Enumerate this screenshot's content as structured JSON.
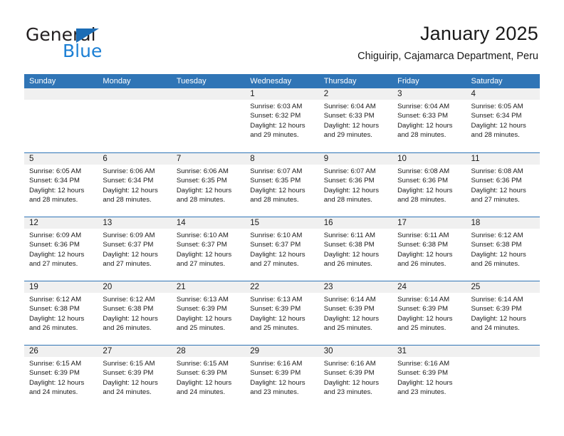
{
  "brand": {
    "name_part1": "General",
    "name_part2": "Blue",
    "triangle_color": "#1b6cb5",
    "blue_color": "#1b7fd4"
  },
  "header": {
    "title": "January 2025",
    "subtitle": "Chiguirip, Cajamarca Department, Peru"
  },
  "theme": {
    "header_blue": "#3075b6",
    "day_band_gray": "#f0f0f0",
    "text_color": "#1a1a1a"
  },
  "weekdays": [
    "Sunday",
    "Monday",
    "Tuesday",
    "Wednesday",
    "Thursday",
    "Friday",
    "Saturday"
  ],
  "weeks": [
    [
      {
        "day": "",
        "empty": true
      },
      {
        "day": "",
        "empty": true
      },
      {
        "day": "",
        "empty": true
      },
      {
        "day": "1",
        "sunrise": "Sunrise: 6:03 AM",
        "sunset": "Sunset: 6:32 PM",
        "daylight": "Daylight: 12 hours and 29 minutes."
      },
      {
        "day": "2",
        "sunrise": "Sunrise: 6:04 AM",
        "sunset": "Sunset: 6:33 PM",
        "daylight": "Daylight: 12 hours and 29 minutes."
      },
      {
        "day": "3",
        "sunrise": "Sunrise: 6:04 AM",
        "sunset": "Sunset: 6:33 PM",
        "daylight": "Daylight: 12 hours and 28 minutes."
      },
      {
        "day": "4",
        "sunrise": "Sunrise: 6:05 AM",
        "sunset": "Sunset: 6:34 PM",
        "daylight": "Daylight: 12 hours and 28 minutes."
      }
    ],
    [
      {
        "day": "5",
        "sunrise": "Sunrise: 6:05 AM",
        "sunset": "Sunset: 6:34 PM",
        "daylight": "Daylight: 12 hours and 28 minutes."
      },
      {
        "day": "6",
        "sunrise": "Sunrise: 6:06 AM",
        "sunset": "Sunset: 6:34 PM",
        "daylight": "Daylight: 12 hours and 28 minutes."
      },
      {
        "day": "7",
        "sunrise": "Sunrise: 6:06 AM",
        "sunset": "Sunset: 6:35 PM",
        "daylight": "Daylight: 12 hours and 28 minutes."
      },
      {
        "day": "8",
        "sunrise": "Sunrise: 6:07 AM",
        "sunset": "Sunset: 6:35 PM",
        "daylight": "Daylight: 12 hours and 28 minutes."
      },
      {
        "day": "9",
        "sunrise": "Sunrise: 6:07 AM",
        "sunset": "Sunset: 6:36 PM",
        "daylight": "Daylight: 12 hours and 28 minutes."
      },
      {
        "day": "10",
        "sunrise": "Sunrise: 6:08 AM",
        "sunset": "Sunset: 6:36 PM",
        "daylight": "Daylight: 12 hours and 28 minutes."
      },
      {
        "day": "11",
        "sunrise": "Sunrise: 6:08 AM",
        "sunset": "Sunset: 6:36 PM",
        "daylight": "Daylight: 12 hours and 27 minutes."
      }
    ],
    [
      {
        "day": "12",
        "sunrise": "Sunrise: 6:09 AM",
        "sunset": "Sunset: 6:36 PM",
        "daylight": "Daylight: 12 hours and 27 minutes."
      },
      {
        "day": "13",
        "sunrise": "Sunrise: 6:09 AM",
        "sunset": "Sunset: 6:37 PM",
        "daylight": "Daylight: 12 hours and 27 minutes."
      },
      {
        "day": "14",
        "sunrise": "Sunrise: 6:10 AM",
        "sunset": "Sunset: 6:37 PM",
        "daylight": "Daylight: 12 hours and 27 minutes."
      },
      {
        "day": "15",
        "sunrise": "Sunrise: 6:10 AM",
        "sunset": "Sunset: 6:37 PM",
        "daylight": "Daylight: 12 hours and 27 minutes."
      },
      {
        "day": "16",
        "sunrise": "Sunrise: 6:11 AM",
        "sunset": "Sunset: 6:38 PM",
        "daylight": "Daylight: 12 hours and 26 minutes."
      },
      {
        "day": "17",
        "sunrise": "Sunrise: 6:11 AM",
        "sunset": "Sunset: 6:38 PM",
        "daylight": "Daylight: 12 hours and 26 minutes."
      },
      {
        "day": "18",
        "sunrise": "Sunrise: 6:12 AM",
        "sunset": "Sunset: 6:38 PM",
        "daylight": "Daylight: 12 hours and 26 minutes."
      }
    ],
    [
      {
        "day": "19",
        "sunrise": "Sunrise: 6:12 AM",
        "sunset": "Sunset: 6:38 PM",
        "daylight": "Daylight: 12 hours and 26 minutes."
      },
      {
        "day": "20",
        "sunrise": "Sunrise: 6:12 AM",
        "sunset": "Sunset: 6:38 PM",
        "daylight": "Daylight: 12 hours and 26 minutes."
      },
      {
        "day": "21",
        "sunrise": "Sunrise: 6:13 AM",
        "sunset": "Sunset: 6:39 PM",
        "daylight": "Daylight: 12 hours and 25 minutes."
      },
      {
        "day": "22",
        "sunrise": "Sunrise: 6:13 AM",
        "sunset": "Sunset: 6:39 PM",
        "daylight": "Daylight: 12 hours and 25 minutes."
      },
      {
        "day": "23",
        "sunrise": "Sunrise: 6:14 AM",
        "sunset": "Sunset: 6:39 PM",
        "daylight": "Daylight: 12 hours and 25 minutes."
      },
      {
        "day": "24",
        "sunrise": "Sunrise: 6:14 AM",
        "sunset": "Sunset: 6:39 PM",
        "daylight": "Daylight: 12 hours and 25 minutes."
      },
      {
        "day": "25",
        "sunrise": "Sunrise: 6:14 AM",
        "sunset": "Sunset: 6:39 PM",
        "daylight": "Daylight: 12 hours and 24 minutes."
      }
    ],
    [
      {
        "day": "26",
        "sunrise": "Sunrise: 6:15 AM",
        "sunset": "Sunset: 6:39 PM",
        "daylight": "Daylight: 12 hours and 24 minutes."
      },
      {
        "day": "27",
        "sunrise": "Sunrise: 6:15 AM",
        "sunset": "Sunset: 6:39 PM",
        "daylight": "Daylight: 12 hours and 24 minutes."
      },
      {
        "day": "28",
        "sunrise": "Sunrise: 6:15 AM",
        "sunset": "Sunset: 6:39 PM",
        "daylight": "Daylight: 12 hours and 24 minutes."
      },
      {
        "day": "29",
        "sunrise": "Sunrise: 6:16 AM",
        "sunset": "Sunset: 6:39 PM",
        "daylight": "Daylight: 12 hours and 23 minutes."
      },
      {
        "day": "30",
        "sunrise": "Sunrise: 6:16 AM",
        "sunset": "Sunset: 6:39 PM",
        "daylight": "Daylight: 12 hours and 23 minutes."
      },
      {
        "day": "31",
        "sunrise": "Sunrise: 6:16 AM",
        "sunset": "Sunset: 6:39 PM",
        "daylight": "Daylight: 12 hours and 23 minutes."
      },
      {
        "day": "",
        "empty": true
      }
    ]
  ]
}
